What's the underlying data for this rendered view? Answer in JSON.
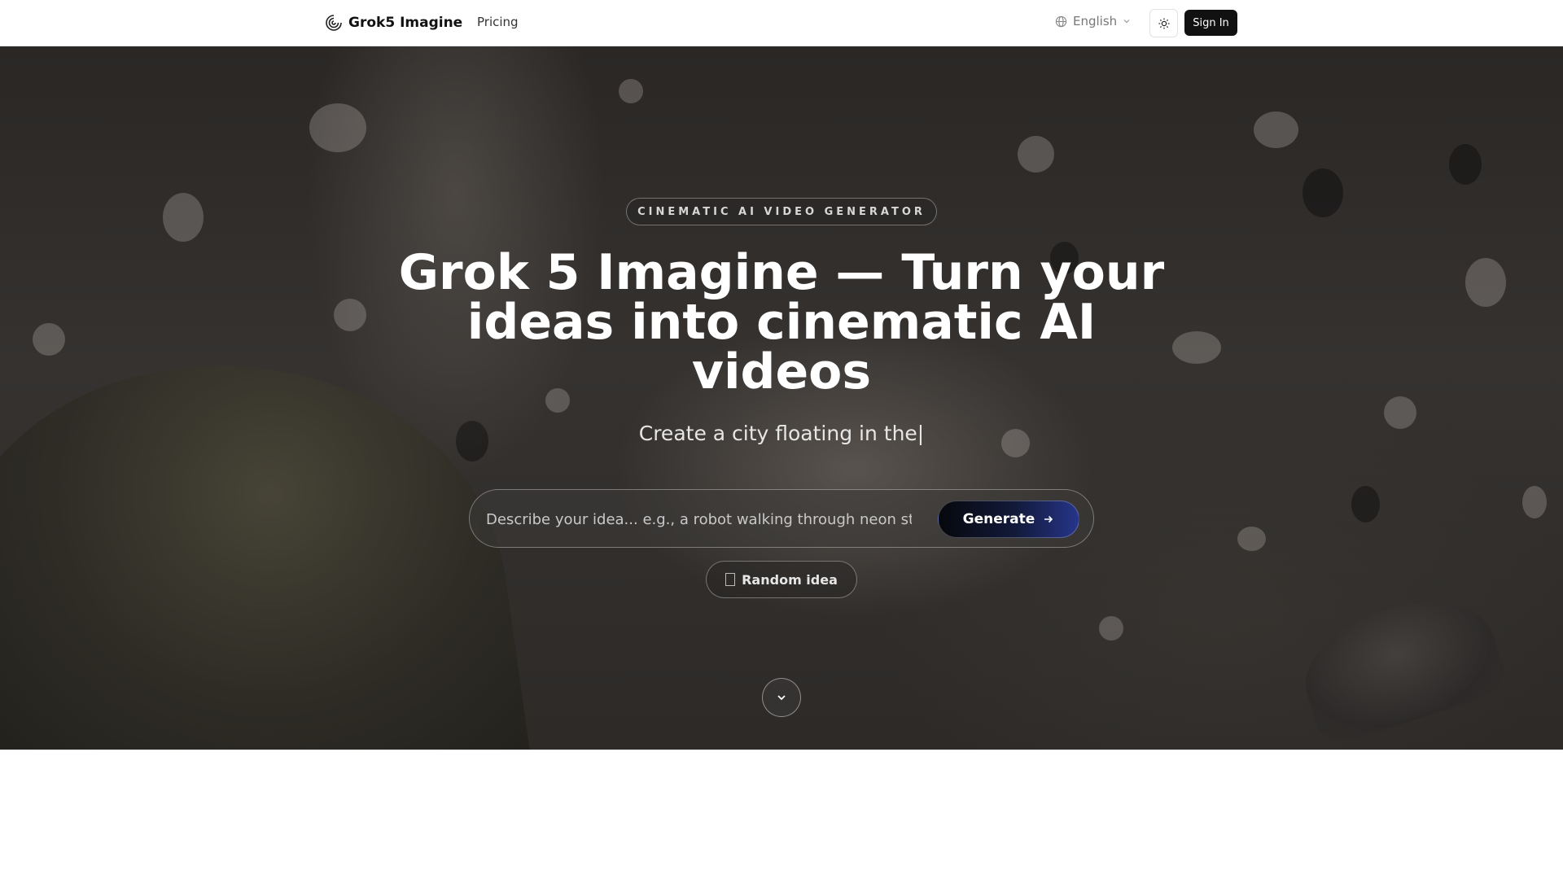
{
  "header": {
    "brand_name": "Grok5 Imagine",
    "nav_pricing": "Pricing",
    "language": "English",
    "sign_in": "Sign In"
  },
  "hero": {
    "badge": "CINEMATIC AI VIDEO GENERATOR",
    "title": "Grok 5 Imagine — Turn your ideas into cinematic AI videos",
    "typing_text": "Create a city floating in the|",
    "search_placeholder": "Describe your idea... e.g., a robot walking through neon streets",
    "generate_label": "Generate",
    "random_label": "Random idea"
  },
  "icons": {
    "brand": "grok-logo-icon",
    "language": "globe-icon",
    "language_caret": "chevron-down-icon",
    "theme": "sun-icon",
    "generate": "arrow-right-icon",
    "scroll": "chevron-down-icon"
  },
  "colors": {
    "signin_bg": "#111111",
    "generate_gradient_start": "#07080d",
    "generate_gradient_end": "#26358a"
  }
}
